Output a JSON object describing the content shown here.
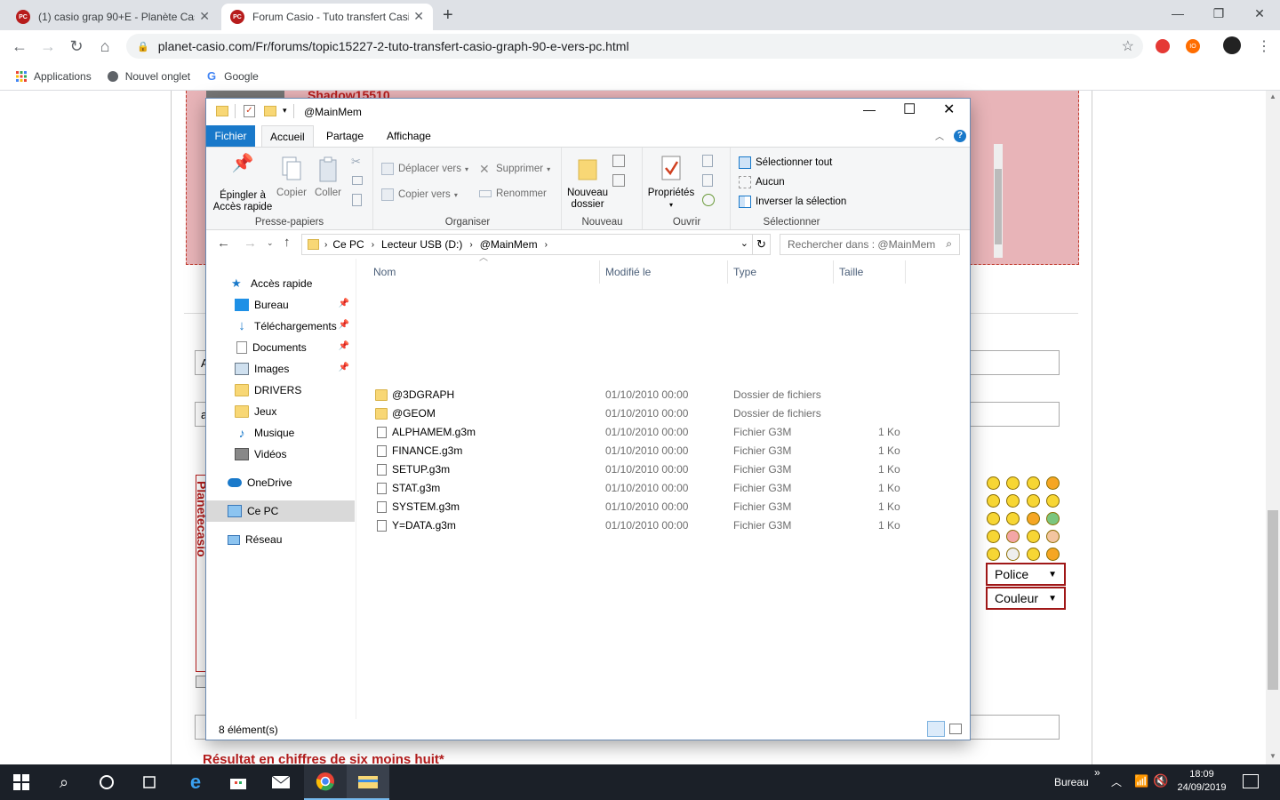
{
  "browser": {
    "tabs": [
      {
        "favicon": "PC",
        "title": "(1) casio grap 90+E - Planète Casi"
      },
      {
        "favicon": "PC",
        "title": "Forum Casio - Tuto transfert Casi"
      }
    ],
    "new_tab": "+",
    "url": "planet-casio.com/Fr/forums/topic15227-2-tuto-transfert-casio-graph-90-e-vers-pc.html",
    "bookmarks": [
      "Applications",
      "Nouvel onglet",
      "Google"
    ]
  },
  "webpage": {
    "username": "Shadow15510",
    "captcha_label": "Résultat en chiffres de six moins huit*",
    "vertical_text": "Planetecasio",
    "police_label": "Police",
    "couleur_label": "Couleur",
    "field_letters": [
      "A",
      "a"
    ]
  },
  "explorer": {
    "title": "@MainMem",
    "ribbon_tabs": [
      "Fichier",
      "Accueil",
      "Partage",
      "Affichage"
    ],
    "ribbon": {
      "presse_papiers": {
        "group": "Presse-papiers",
        "pin": "Épingler à\nAccès rapide",
        "copy": "Copier",
        "paste": "Coller"
      },
      "organiser": {
        "group": "Organiser",
        "move": "Déplacer vers",
        "copyto": "Copier vers",
        "delete": "Supprimer",
        "rename": "Renommer"
      },
      "nouveau": {
        "group": "Nouveau",
        "newfolder": "Nouveau\ndossier"
      },
      "ouvrir": {
        "group": "Ouvrir",
        "props": "Propriétés"
      },
      "selectionner": {
        "group": "Sélectionner",
        "all": "Sélectionner tout",
        "none": "Aucun",
        "invert": "Inverser la sélection"
      }
    },
    "breadcrumb": [
      "Ce PC",
      "Lecteur USB (D:)",
      "@MainMem"
    ],
    "search_placeholder": "Rechercher dans : @MainMem",
    "nav": [
      {
        "label": "Accès rapide",
        "icon": "star-icon",
        "pinned": false
      },
      {
        "label": "Bureau",
        "icon": "desktop-icon",
        "pinned": true
      },
      {
        "label": "Téléchargements",
        "icon": "download-icon",
        "pinned": true
      },
      {
        "label": "Documents",
        "icon": "documents-icon",
        "pinned": true
      },
      {
        "label": "Images",
        "icon": "images-icon",
        "pinned": true
      },
      {
        "label": "DRIVERS",
        "icon": "folder-icon",
        "pinned": false
      },
      {
        "label": "Jeux",
        "icon": "folder-icon",
        "pinned": false
      },
      {
        "label": "Musique",
        "icon": "music-icon",
        "pinned": false
      },
      {
        "label": "Vidéos",
        "icon": "videos-icon",
        "pinned": false
      },
      {
        "label": "OneDrive",
        "icon": "cloud-icon",
        "pinned": false
      },
      {
        "label": "Ce PC",
        "icon": "pc-icon",
        "pinned": false,
        "selected": true
      },
      {
        "label": "Réseau",
        "icon": "network-icon",
        "pinned": false
      }
    ],
    "columns": [
      "Nom",
      "Modifié le",
      "Type",
      "Taille"
    ],
    "files": [
      {
        "name": "@3DGRAPH",
        "date": "01/10/2010 00:00",
        "type": "Dossier de fichiers",
        "size": "",
        "kind": "folder"
      },
      {
        "name": "@GEOM",
        "date": "01/10/2010 00:00",
        "type": "Dossier de fichiers",
        "size": "",
        "kind": "folder"
      },
      {
        "name": "ALPHAMEM.g3m",
        "date": "01/10/2010 00:00",
        "type": "Fichier G3M",
        "size": "1 Ko",
        "kind": "file"
      },
      {
        "name": "FINANCE.g3m",
        "date": "01/10/2010 00:00",
        "type": "Fichier G3M",
        "size": "1 Ko",
        "kind": "file"
      },
      {
        "name": "SETUP.g3m",
        "date": "01/10/2010 00:00",
        "type": "Fichier G3M",
        "size": "1 Ko",
        "kind": "file"
      },
      {
        "name": "STAT.g3m",
        "date": "01/10/2010 00:00",
        "type": "Fichier G3M",
        "size": "1 Ko",
        "kind": "file"
      },
      {
        "name": "SYSTEM.g3m",
        "date": "01/10/2010 00:00",
        "type": "Fichier G3M",
        "size": "1 Ko",
        "kind": "file"
      },
      {
        "name": "Y=DATA.g3m",
        "date": "01/10/2010 00:00",
        "type": "Fichier G3M",
        "size": "1 Ko",
        "kind": "file"
      }
    ],
    "status": "8 élément(s)"
  },
  "taskbar": {
    "desktop_label": "Bureau",
    "time": "18:09",
    "date": "24/09/2019"
  },
  "colors": {
    "accent": "#1979ca",
    "pink_post": "#e8b4b8",
    "red_label": "#b71c1c",
    "taskbar": "#1b2028"
  }
}
